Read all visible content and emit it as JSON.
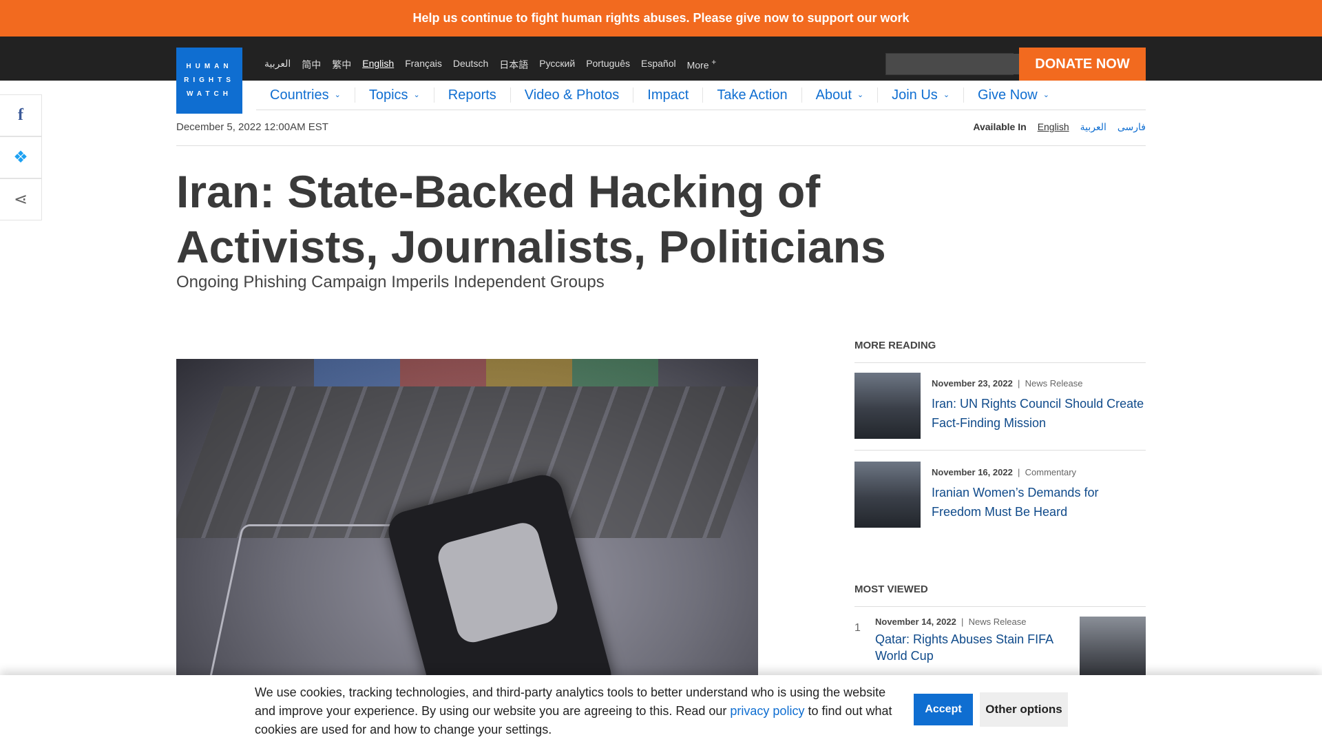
{
  "banner": {
    "text": "Help us continue to fight human rights abuses. Please give now to support our work"
  },
  "logo": {
    "lines": [
      "HUMAN",
      "RIGHTS",
      "WATCH"
    ]
  },
  "languages": [
    "العربية",
    "简中",
    "繁中",
    "English",
    "Français",
    "Deutsch",
    "日本語",
    "Русский",
    "Português",
    "Español",
    "More"
  ],
  "active_language": "English",
  "search": {
    "placeholder": "",
    "icon": "search-icon"
  },
  "donate": {
    "label": "DONATE NOW"
  },
  "nav": [
    {
      "label": "Countries",
      "has_dropdown": true
    },
    {
      "label": "Topics",
      "has_dropdown": true
    },
    {
      "label": "Reports",
      "has_dropdown": false
    },
    {
      "label": "Video & Photos",
      "has_dropdown": false
    },
    {
      "label": "Impact",
      "has_dropdown": false
    },
    {
      "label": "Take Action",
      "has_dropdown": false
    },
    {
      "label": "About",
      "has_dropdown": true
    },
    {
      "label": "Join Us",
      "has_dropdown": true
    },
    {
      "label": "Give Now",
      "has_dropdown": true
    }
  ],
  "share": {
    "facebook_icon": "f",
    "twitter_icon": "🐦",
    "share_icon": "⋖"
  },
  "article": {
    "date": "December 5, 2022 12:00AM EST",
    "available_in_label": "Available In",
    "available_in": [
      "English",
      "العربية",
      "فارسی"
    ],
    "title": "Iran: State-Backed Hacking of Activists, Journalists, Politicians",
    "subtitle": "Ongoing Phishing Campaign Imperils Independent Groups"
  },
  "more_reading": {
    "heading": "More Reading",
    "items": [
      {
        "date": "November 23, 2022",
        "type": "News Release",
        "title": "Iran: UN Rights Council Should Create Fact-Finding Mission"
      },
      {
        "date": "November 16, 2022",
        "type": "Commentary",
        "title": "Iranian Women’s Demands for Freedom Must Be Heard"
      }
    ]
  },
  "most_viewed": {
    "heading": "Most Viewed",
    "items": [
      {
        "rank": "1",
        "date": "November 14, 2022",
        "type": "News Release",
        "title": "Qatar: Rights Abuses Stain FIFA World Cup"
      }
    ]
  },
  "cookie": {
    "text_before": "We use cookies, tracking technologies, and third-party analytics tools to better understand who is using the website and improve your experience. By using our website you are agreeing to this. Read our",
    "link": "privacy policy",
    "text_after": "to find out what cookies are used for and how to change your settings.",
    "accept": "Accept",
    "other": "Other options"
  }
}
